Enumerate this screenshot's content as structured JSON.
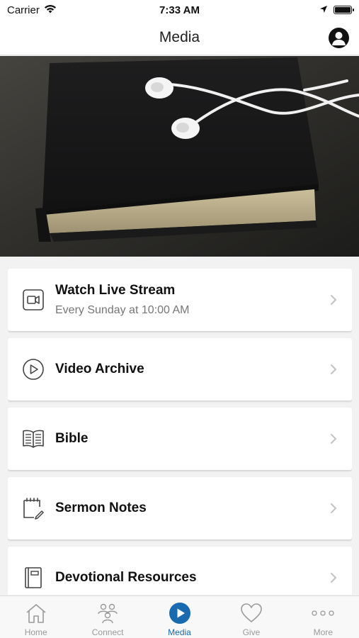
{
  "status_bar": {
    "carrier": "Carrier",
    "time": "7:33 AM"
  },
  "header": {
    "title": "Media"
  },
  "hero": {
    "description_icon": "headphones-on-bible-image"
  },
  "menu": {
    "items": [
      {
        "title": "Watch Live Stream",
        "subtitle": "Every Sunday at 10:00 AM",
        "icon": "video-camera-icon"
      },
      {
        "title": "Video Archive",
        "icon": "play-circle-icon"
      },
      {
        "title": "Bible",
        "icon": "open-book-icon"
      },
      {
        "title": "Sermon Notes",
        "icon": "notepad-pencil-icon"
      },
      {
        "title": "Devotional Resources",
        "icon": "book-icon"
      }
    ]
  },
  "tab_bar": {
    "tabs": [
      {
        "label": "Home",
        "icon": "home-icon"
      },
      {
        "label": "Connect",
        "icon": "people-icon"
      },
      {
        "label": "Media",
        "icon": "play-circle-filled-icon",
        "active": true
      },
      {
        "label": "Give",
        "icon": "heart-icon"
      },
      {
        "label": "More",
        "icon": "more-dots-icon"
      }
    ]
  },
  "colors": {
    "accent": "#1a6ab0",
    "tab_inactive": "#999999",
    "background": "#f2f2f2"
  }
}
